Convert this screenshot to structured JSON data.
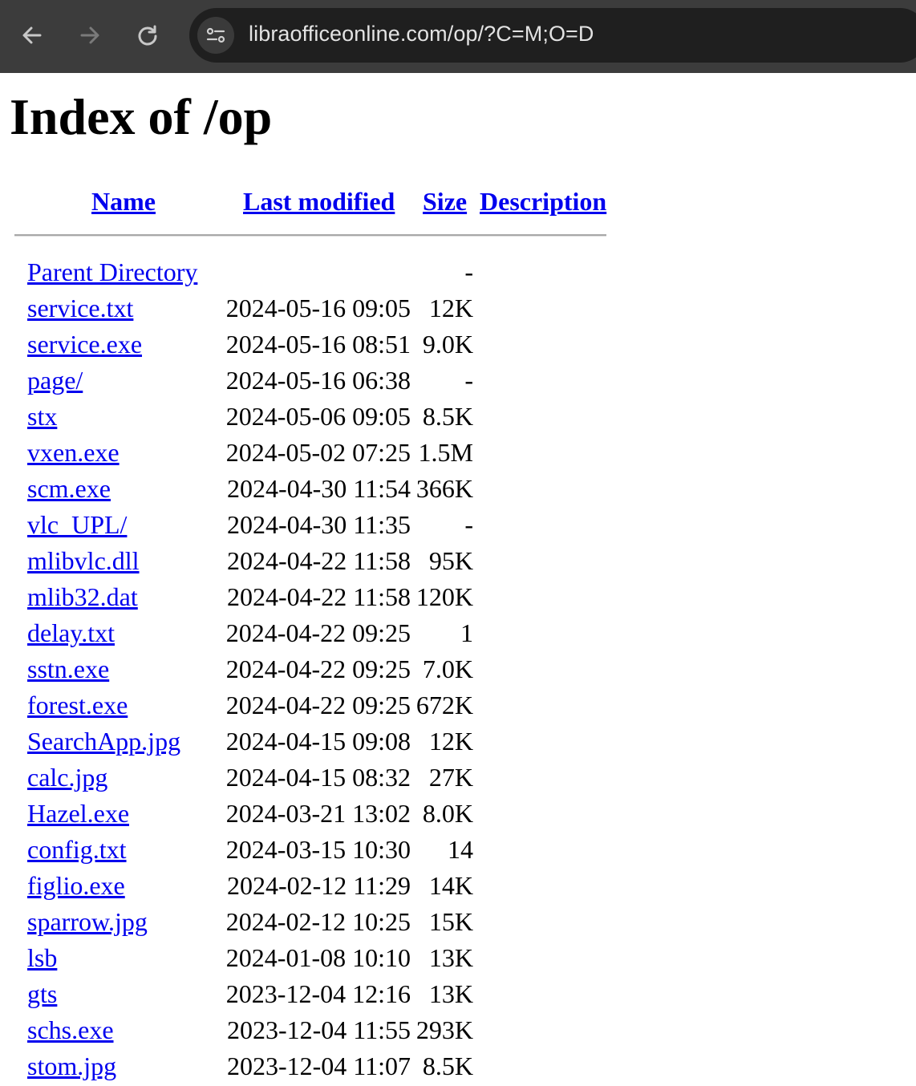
{
  "browser": {
    "url": "libraofficeonline.com/op/?C=M;O=D",
    "icons": {
      "back": "arrow-left-icon",
      "forward": "arrow-right-icon",
      "reload": "reload-icon",
      "site_info": "tune-icon"
    }
  },
  "page": {
    "title": "Index of /op",
    "columns": {
      "name": "Name",
      "last_modified": "Last modified",
      "size": "Size",
      "description": "Description"
    },
    "rows": [
      {
        "name": "Parent Directory",
        "date": "",
        "size": "-"
      },
      {
        "name": "service.txt",
        "date": "2024-05-16 09:05",
        "size": "12K"
      },
      {
        "name": "service.exe",
        "date": "2024-05-16 08:51",
        "size": "9.0K"
      },
      {
        "name": "page/",
        "date": "2024-05-16 06:38",
        "size": "-"
      },
      {
        "name": "stx",
        "date": "2024-05-06 09:05",
        "size": "8.5K"
      },
      {
        "name": "vxen.exe",
        "date": "2024-05-02 07:25",
        "size": "1.5M"
      },
      {
        "name": "scm.exe",
        "date": "2024-04-30 11:54",
        "size": "366K"
      },
      {
        "name": "vlc_UPL/",
        "date": "2024-04-30 11:35",
        "size": "-"
      },
      {
        "name": "mlibvlc.dll",
        "date": "2024-04-22 11:58",
        "size": "95K"
      },
      {
        "name": "mlib32.dat",
        "date": "2024-04-22 11:58",
        "size": "120K"
      },
      {
        "name": "delay.txt",
        "date": "2024-04-22 09:25",
        "size": "1"
      },
      {
        "name": "sstn.exe",
        "date": "2024-04-22 09:25",
        "size": "7.0K"
      },
      {
        "name": "forest.exe",
        "date": "2024-04-22 09:25",
        "size": "672K"
      },
      {
        "name": "SearchApp.jpg",
        "date": "2024-04-15 09:08",
        "size": "12K"
      },
      {
        "name": "calc.jpg",
        "date": "2024-04-15 08:32",
        "size": "27K"
      },
      {
        "name": "Hazel.exe",
        "date": "2024-03-21 13:02",
        "size": "8.0K"
      },
      {
        "name": "config.txt",
        "date": "2024-03-15 10:30",
        "size": "14"
      },
      {
        "name": "figlio.exe",
        "date": "2024-02-12 11:29",
        "size": "14K"
      },
      {
        "name": "sparrow.jpg",
        "date": "2024-02-12 10:25",
        "size": "15K"
      },
      {
        "name": "lsb",
        "date": "2024-01-08 10:10",
        "size": "13K"
      },
      {
        "name": "gts",
        "date": "2023-12-04 12:16",
        "size": "13K"
      },
      {
        "name": "schs.exe",
        "date": "2023-12-04 11:55",
        "size": "293K"
      },
      {
        "name": "stom.jpg",
        "date": "2023-12-04 11:07",
        "size": "8.5K"
      }
    ]
  }
}
